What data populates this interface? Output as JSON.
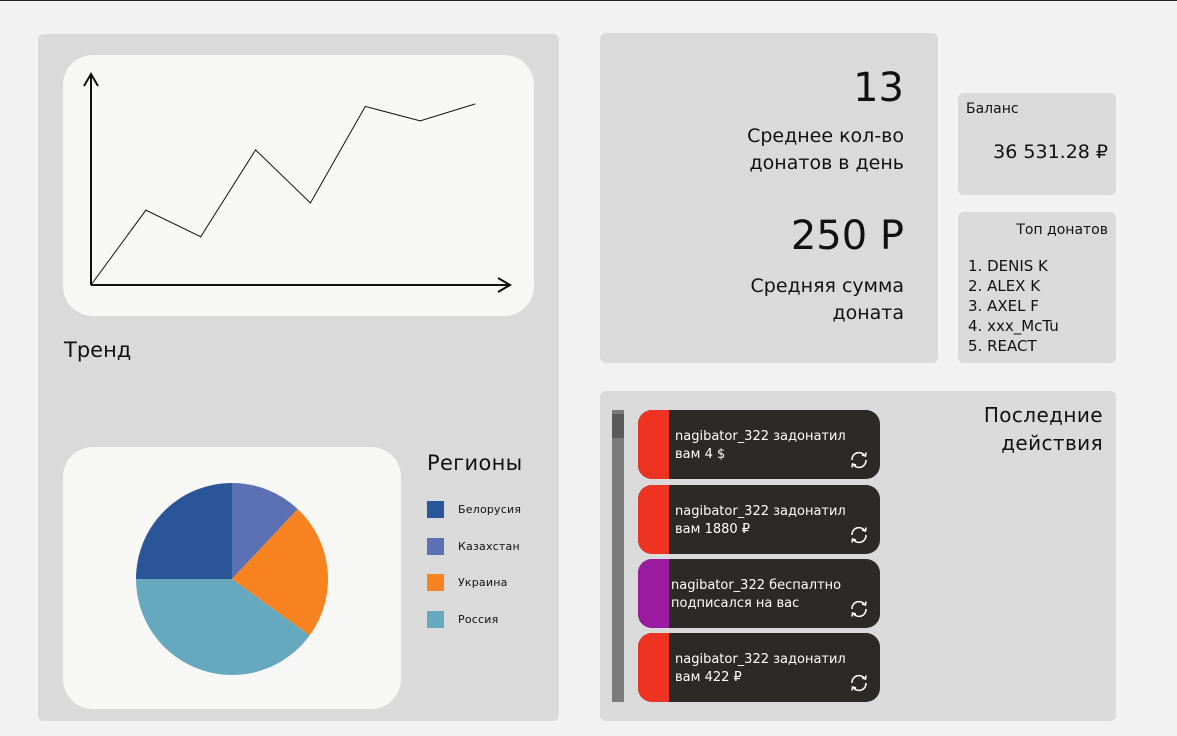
{
  "trend": {
    "label": "Тренд",
    "chart_data": {
      "type": "line",
      "values": [
        0,
        31,
        20,
        56,
        34,
        74,
        68,
        75
      ]
    }
  },
  "regions": {
    "title": "Регионы",
    "chart_data": {
      "type": "pie",
      "categories": [
        "Белорусия",
        "Казахстан",
        "Украина",
        "Россия"
      ],
      "values": [
        25,
        12,
        23,
        40
      ],
      "colors": [
        "#2a5599",
        "#5c71b4",
        "#f6831f",
        "#66a8bd"
      ]
    }
  },
  "stats": {
    "avg_count": "13",
    "avg_count_label": "Среднее кол-во донатов в день",
    "avg_sum": "250 Р",
    "avg_sum_label": "Средняя сумма доната"
  },
  "balance": {
    "title": "Баланс",
    "value": "36 531.28 ₽"
  },
  "top_donations": {
    "title": "Топ донатов",
    "items": [
      "1. DENIS K",
      "2. ALEX K",
      "3. AXEL F",
      "4. xxx_McTu",
      "5. REACT"
    ]
  },
  "actions": {
    "title": "Последние действия",
    "items": [
      {
        "text": "nagibator_322 задонатил вам 4 $",
        "accent": "#ef3322",
        "icon": "refresh-icon"
      },
      {
        "text": "nagibator_322 задонатил вам 1880 ₽",
        "accent": "#ef3322",
        "icon": "refresh-icon"
      },
      {
        "text": "nagibator_322 беспалтно подписался на вас",
        "accent": "#9a1aa0",
        "icon": "refresh-icon"
      },
      {
        "text": "nagibator_322 задонатил вам 422 ₽",
        "accent": "#ef3322",
        "icon": "refresh-icon"
      }
    ]
  }
}
